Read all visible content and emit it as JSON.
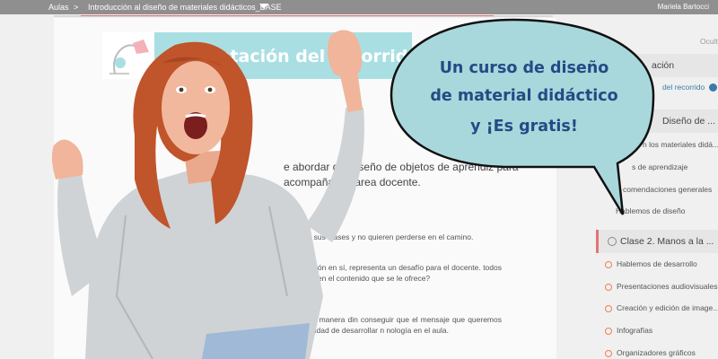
{
  "topbar": {
    "crumb": "Aulas",
    "separator": ">",
    "course": "Introducción al diseño de materiales didácticos_BASE",
    "user": "Mariela Bartocci"
  },
  "banner": {
    "title": "entación del recorrid"
  },
  "intro": "e abordar del diseño de objetos de aprendiz para acompañar la tarea docente.",
  "body": {
    "p1": "emos herramientas de uso libre y gratuito para diseño en C en sus clases y no quieren perderse en el camino.",
    "p2": "ser muy visuales, con períodos cortos de atención más nunicación en sí, representa un desafío para el docente. todos los recursos empleados en el diseño didáctico, ntado enfocarse en el contenido que se le ofrece?",
    "p3": "Muchos do ntan dificultades para presentar contenidos de una manera din conseguir que el mensaje que queremos dar sea significativo os estudiantes. Por eso, sentimos la necesidad de desarrollar n nología en el aula."
  },
  "sidebar": {
    "hidden_label": "Ocult",
    "items": [
      {
        "label": "ación"
      },
      {
        "label": "del recorrido"
      },
      {
        "label": "Diseño de ..."
      },
      {
        "label": "n los materiales didá..."
      },
      {
        "label": "s de aprendizaje"
      },
      {
        "label": "comendaciones generales"
      },
      {
        "label": "Hablemos de diseño"
      },
      {
        "label": "Clase 2. Manos a la ..."
      },
      {
        "label": "Hablemos de desarrollo"
      },
      {
        "label": "Presentaciones audiovisuales"
      },
      {
        "label": "Creación y edición de image..."
      },
      {
        "label": "Infografías"
      },
      {
        "label": "Organizadores gráficos"
      }
    ]
  },
  "bubble": {
    "line1": "Un curso de diseño",
    "line2": "de material didáctico",
    "line3": "y ¡Es  gratis!"
  },
  "colors": {
    "accent": "#ef7d55",
    "bubble_fill": "#a8d8dc",
    "bubble_text": "#234b85",
    "banner": "#a9dfe3"
  }
}
